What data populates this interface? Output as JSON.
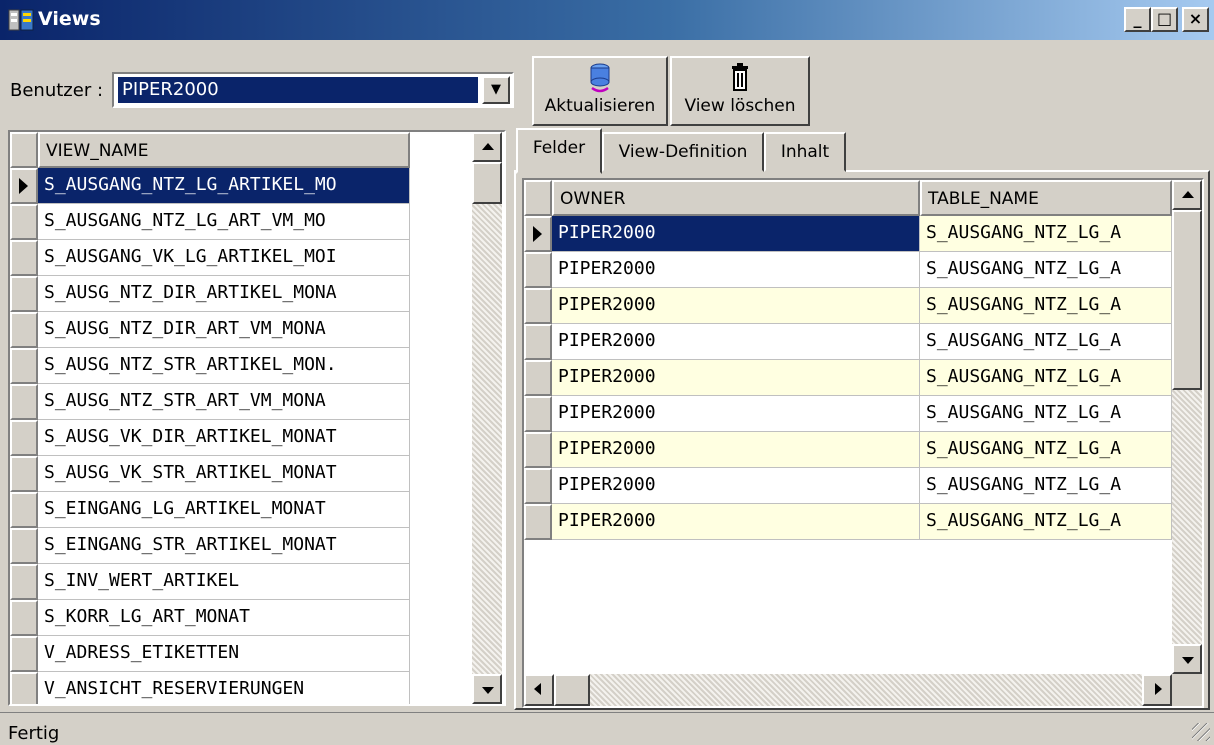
{
  "window": {
    "title": "Views",
    "min_glyph": "_",
    "max_glyph": "□",
    "close_glyph": "×"
  },
  "user": {
    "label": "Benutzer :",
    "selected": "PIPER2000"
  },
  "toolbar": {
    "refresh_label": "Aktualisieren",
    "delete_label": "View löschen"
  },
  "views_grid": {
    "header": "VIEW_NAME",
    "rows": [
      "S_AUSGANG_NTZ_LG_ARTIKEL_MO",
      "S_AUSGANG_NTZ_LG_ART_VM_MO",
      "S_AUSGANG_VK_LG_ARTIKEL_MOI",
      "S_AUSG_NTZ_DIR_ARTIKEL_MONA",
      "S_AUSG_NTZ_DIR_ART_VM_MONA",
      "S_AUSG_NTZ_STR_ARTIKEL_MON.",
      "S_AUSG_NTZ_STR_ART_VM_MONA",
      "S_AUSG_VK_DIR_ARTIKEL_MONAT",
      "S_AUSG_VK_STR_ARTIKEL_MONAT",
      "S_EINGANG_LG_ARTIKEL_MONAT",
      "S_EINGANG_STR_ARTIKEL_MONAT",
      "S_INV_WERT_ARTIKEL",
      "S_KORR_LG_ART_MONAT",
      "V_ADRESS_ETIKETTEN",
      "V_ANSICHT_RESERVIERUNGEN"
    ]
  },
  "tabs": {
    "fields": "Felder",
    "definition": "View-Definition",
    "content": "Inhalt"
  },
  "fields_grid": {
    "headers": [
      "OWNER",
      "TABLE_NAME"
    ],
    "rows": [
      [
        "PIPER2000",
        "S_AUSGANG_NTZ_LG_A"
      ],
      [
        "PIPER2000",
        "S_AUSGANG_NTZ_LG_A"
      ],
      [
        "PIPER2000",
        "S_AUSGANG_NTZ_LG_A"
      ],
      [
        "PIPER2000",
        "S_AUSGANG_NTZ_LG_A"
      ],
      [
        "PIPER2000",
        "S_AUSGANG_NTZ_LG_A"
      ],
      [
        "PIPER2000",
        "S_AUSGANG_NTZ_LG_A"
      ],
      [
        "PIPER2000",
        "S_AUSGANG_NTZ_LG_A"
      ],
      [
        "PIPER2000",
        "S_AUSGANG_NTZ_LG_A"
      ],
      [
        "PIPER2000",
        "S_AUSGANG_NTZ_LG_A"
      ]
    ]
  },
  "status": {
    "text": "Fertig"
  },
  "colors": {
    "selection": "#0a246a",
    "alt_row": "#ffffe1",
    "face": "#d4d0c8"
  }
}
